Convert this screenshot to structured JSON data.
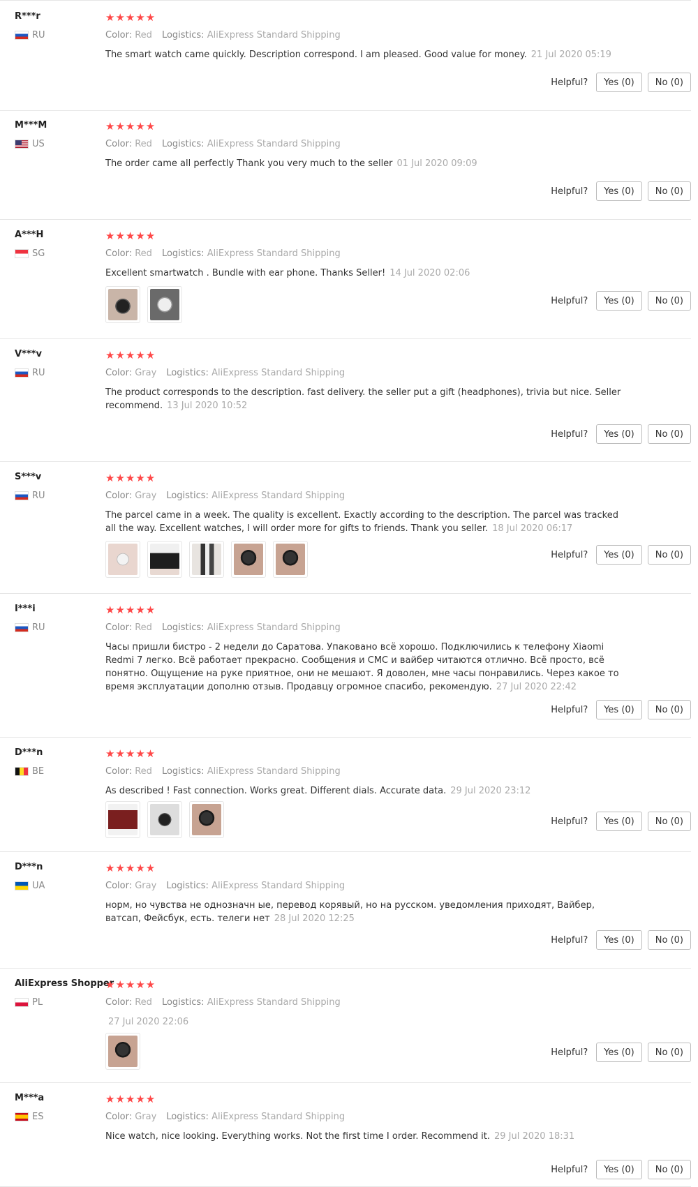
{
  "helpful_label": "Helpful?",
  "colors": {
    "star": "#ff4747"
  },
  "reviews": [
    {
      "user": "R***r",
      "country": "RU",
      "flag": "ru",
      "stars": "★★★★★",
      "color_label": "Color:",
      "color_value": "Red",
      "logistics_label": "Logistics:",
      "logistics_value": "AliExpress Standard Shipping",
      "text": "The smart watch came quickly. Description correspond. I am pleased. Good value for money.",
      "date": "21 Jul 2020 05:19",
      "photos": [],
      "yes": "Yes (0)",
      "no": "No (0)"
    },
    {
      "user": "M***M",
      "country": "US",
      "flag": "us",
      "stars": "★★★★★",
      "color_label": "Color:",
      "color_value": "Red",
      "logistics_label": "Logistics:",
      "logistics_value": "AliExpress Standard Shipping",
      "text": "The order came all perfectly Thank you very much to the seller",
      "date": "01 Jul 2020 09:09",
      "photos": [],
      "yes": "Yes (0)",
      "no": "No (0)"
    },
    {
      "user": "A***H",
      "country": "SG",
      "flag": "sg",
      "stars": "★★★★★",
      "color_label": "Color:",
      "color_value": "Red",
      "logistics_label": "Logistics:",
      "logistics_value": "AliExpress Standard Shipping",
      "text": "Excellent smartwatch . Bundle with ear phone. Thanks Seller!",
      "date": "14 Jul 2020 02:06",
      "photos": [
        "watchdark",
        "watchlight"
      ],
      "yes": "Yes (0)",
      "no": "No (0)"
    },
    {
      "user": "V***v",
      "country": "RU",
      "flag": "ru",
      "stars": "★★★★★",
      "color_label": "Color:",
      "color_value": "Gray",
      "logistics_label": "Logistics:",
      "logistics_value": "AliExpress Standard Shipping",
      "text": "The product corresponds to the description. fast delivery. the seller put a gift (headphones), trivia but nice. Seller recommend.",
      "date": "13 Jul 2020 10:52",
      "photos": [],
      "yes": "Yes (0)",
      "no": "No (0)"
    },
    {
      "user": "S***v",
      "country": "RU",
      "flag": "ru",
      "stars": "★★★★★",
      "color_label": "Color:",
      "color_value": "Gray",
      "logistics_label": "Logistics:",
      "logistics_value": "AliExpress Standard Shipping",
      "text": "The parcel came in a week. The quality is excellent. Exactly according to the description. The parcel was tracked all the way. Excellent watches, I will order more for gifts to friends. Thank you seller.",
      "date": "18 Jul 2020 06:17",
      "photos": [
        "box",
        "boxdark",
        "items",
        "wrist",
        "wrist"
      ],
      "yes": "Yes (0)",
      "no": "No (0)"
    },
    {
      "user": "I***i",
      "country": "RU",
      "flag": "ru",
      "stars": "★★★★★",
      "color_label": "Color:",
      "color_value": "Red",
      "logistics_label": "Logistics:",
      "logistics_value": "AliExpress Standard Shipping",
      "text": "Часы пришли бистро - 2 недели до Саратова. Упаковано всё хорошо. Подключились к телефону Xiaomi Redmi 7 легко. Всё работает прекрасно. Сообщения и СМС и вайбер читаются отлично. Всё просто, всё понятно. Ощущение на руке приятное, они не мешают. Я доволен, мне часы понравились. Через какое то время эксплуатации дополню отзыв. Продавцу огромное спасибо, рекомендую.",
      "date": "27 Jul 2020 22:42",
      "photos": [],
      "yes": "Yes (0)",
      "no": "No (0)"
    },
    {
      "user": "D***n",
      "country": "BE",
      "flag": "be",
      "stars": "★★★★★",
      "color_label": "Color:",
      "color_value": "Red",
      "logistics_label": "Logistics:",
      "logistics_value": "AliExpress Standard Shipping",
      "text": "As described ! Fast connection. Works great. Different dials. Accurate data.",
      "date": "29 Jul 2020 23:12",
      "photos": [
        "redstrap",
        "strap",
        "wrist"
      ],
      "yes": "Yes (0)",
      "no": "No (0)"
    },
    {
      "user": "D***n",
      "country": "UA",
      "flag": "ua",
      "stars": "★★★★★",
      "color_label": "Color:",
      "color_value": "Gray",
      "logistics_label": "Logistics:",
      "logistics_value": "AliExpress Standard Shipping",
      "text": "норм, но чувства не однозначн ые, перевод корявый, но на русском. уведомления приходят, Вайбер, ватсап, Фейсбук, есть. телеги нет",
      "date": "28 Jul 2020 12:25",
      "photos": [],
      "yes": "Yes (0)",
      "no": "No (0)"
    },
    {
      "user": "AliExpress Shopper",
      "country": "PL",
      "flag": "pl",
      "stars": "★★★★★",
      "color_label": "Color:",
      "color_value": "Red",
      "logistics_label": "Logistics:",
      "logistics_value": "AliExpress Standard Shipping",
      "text": "",
      "date": "27 Jul 2020 22:06",
      "photos": [
        "wrist"
      ],
      "yes": "Yes (0)",
      "no": "No (0)"
    },
    {
      "user": "M***a",
      "country": "ES",
      "flag": "es",
      "stars": "★★★★★",
      "color_label": "Color:",
      "color_value": "Gray",
      "logistics_label": "Logistics:",
      "logistics_value": "AliExpress Standard Shipping",
      "text": "Nice watch, nice looking. Everything works. Not the first time I order. Recommend it.",
      "date": "29 Jul 2020 18:31",
      "photos": [],
      "yes": "Yes (0)",
      "no": "No (0)"
    }
  ]
}
